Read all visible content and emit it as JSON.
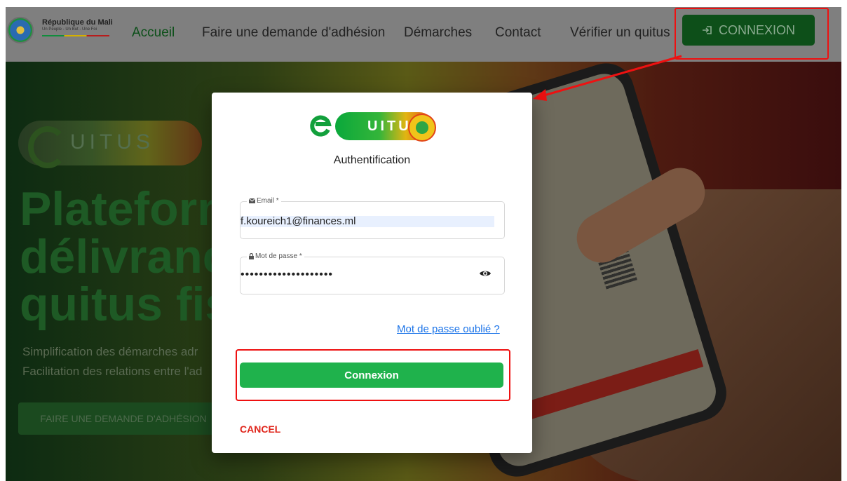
{
  "header": {
    "brand_title": "République du Mali",
    "brand_motto": "Un Peuple - Un But - Une Foi",
    "nav": [
      "Accueil",
      "Faire une demande d'adhésion",
      "Démarches",
      "Contact",
      "Vérifier un quitus"
    ],
    "connexion_button": "CONNEXION",
    "connexion_icon": "login-icon"
  },
  "hero": {
    "logo_text": "UITUS",
    "headline": [
      "Plateform",
      "délivrance",
      "quitus fis"
    ],
    "subtitle": [
      "Simplification des démarches adr",
      "Facilitation des relations entre l'ad"
    ],
    "cta": "FAIRE UNE DEMANDE D'ADHÉSION"
  },
  "modal": {
    "logo_text": "UITUS",
    "title": "Authentification",
    "email_label": "Email *",
    "email_value": "f.koureich1@finances.ml",
    "password_label": "Mot de passe *",
    "password_value": "••••••••••••••••••••",
    "forgot_link": "Mot de passe oublié ?",
    "submit": "Connexion",
    "cancel": "CANCEL"
  },
  "colors": {
    "primary_green": "#1fb24c",
    "dark_green": "#0d4f19",
    "cancel_red": "#e0261c",
    "link_blue": "#1a73e8",
    "annotation_red": "#ee1111"
  }
}
